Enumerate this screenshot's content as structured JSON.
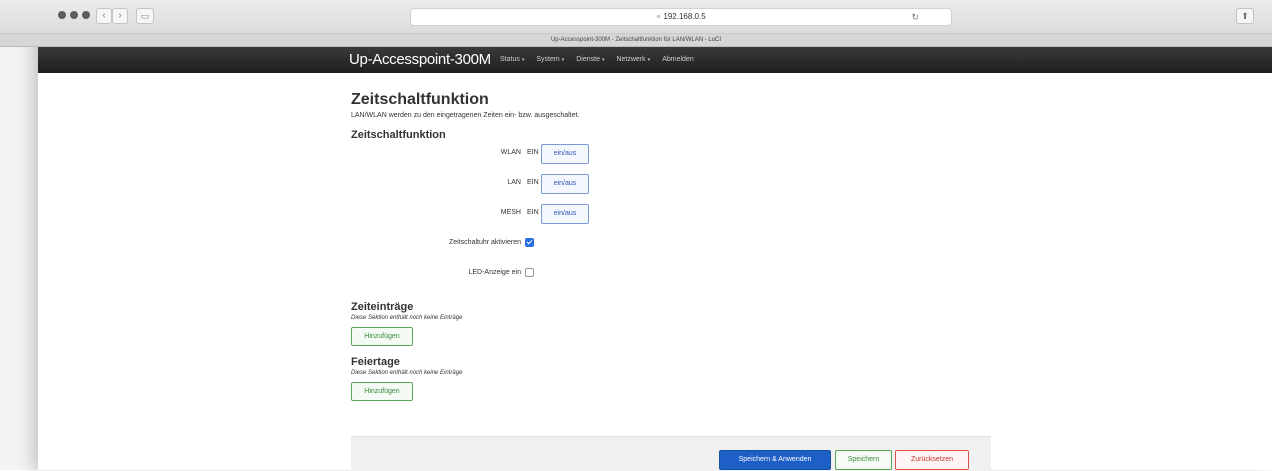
{
  "browser": {
    "url": "192.168.0.5",
    "tab_title": "Up-Accesspoint-300M - Zeitschaltfunktion für LAN/WLAN - LuCI",
    "reload_icon": "↻",
    "share_icon": "⬆"
  },
  "header": {
    "brand": "Up-Accesspoint-300M",
    "menu": [
      {
        "label": "Status"
      },
      {
        "label": "System"
      },
      {
        "label": "Dienste"
      },
      {
        "label": "Netzwerk"
      },
      {
        "label": "Abmelden"
      }
    ],
    "caret": "▾"
  },
  "page": {
    "title": "Zeitschaltfunktion",
    "description": "LAN/WLAN werden zu den eingetragenen Zeiten ein- bzw. ausgeschaltet."
  },
  "settings": {
    "section_title": "Zeitschaltfunktion",
    "rows": [
      {
        "label": "WLAN",
        "state": "EIN",
        "button": "ein/aus"
      },
      {
        "label": "LAN",
        "state": "EIN",
        "button": "ein/aus"
      },
      {
        "label": "MESH",
        "state": "EIN",
        "button": "ein/aus"
      }
    ],
    "timer_label": "Zeitschaltuhr aktivieren",
    "timer_checked": true,
    "led_label": "LED-Anzeige ein",
    "led_checked": false
  },
  "time_entries": {
    "title": "Zeiteinträge",
    "desc": "Diese Sektion enthält noch keine Einträge",
    "add_label": "Hinzufügen"
  },
  "holidays": {
    "title": "Feiertage",
    "desc": "Diese Sektion enthält noch keine Einträge",
    "add_label": "Hinzufügen"
  },
  "footer": {
    "apply_label": "Speichern & Anwenden",
    "save_label": "Speichern",
    "reset_label": "Zurücksetzen"
  }
}
